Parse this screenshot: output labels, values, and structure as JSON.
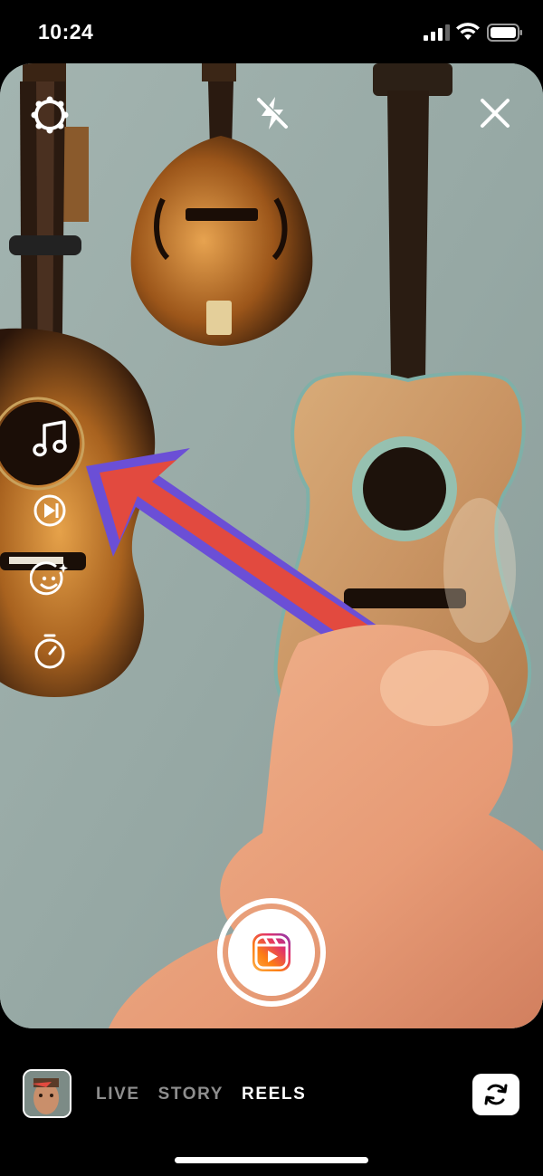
{
  "status_bar": {
    "time": "10:24"
  },
  "camera": {
    "top_controls": {
      "settings_icon": "gear-icon",
      "flash_icon": "flash-off-icon",
      "close_icon": "close-icon"
    },
    "side_tools": [
      {
        "name": "music",
        "icon": "music-note-icon"
      },
      {
        "name": "speed",
        "icon": "play-speed-icon"
      },
      {
        "name": "effects",
        "icon": "face-effects-icon"
      },
      {
        "name": "timer",
        "icon": "timer-icon"
      }
    ],
    "shutter": {
      "icon": "reels-icon",
      "gradient": [
        "#833ab4",
        "#e1306c",
        "#fd7e14",
        "#fcaf45"
      ]
    }
  },
  "bottom_bar": {
    "modes": [
      {
        "label": "LIVE",
        "active": false
      },
      {
        "label": "STORY",
        "active": false
      },
      {
        "label": "REELS",
        "active": true
      }
    ],
    "flip_icon": "camera-flip-icon"
  },
  "colors": {
    "accent_inactive": "#8e8e8e",
    "accent_active": "#ffffff",
    "background": "#000000"
  }
}
